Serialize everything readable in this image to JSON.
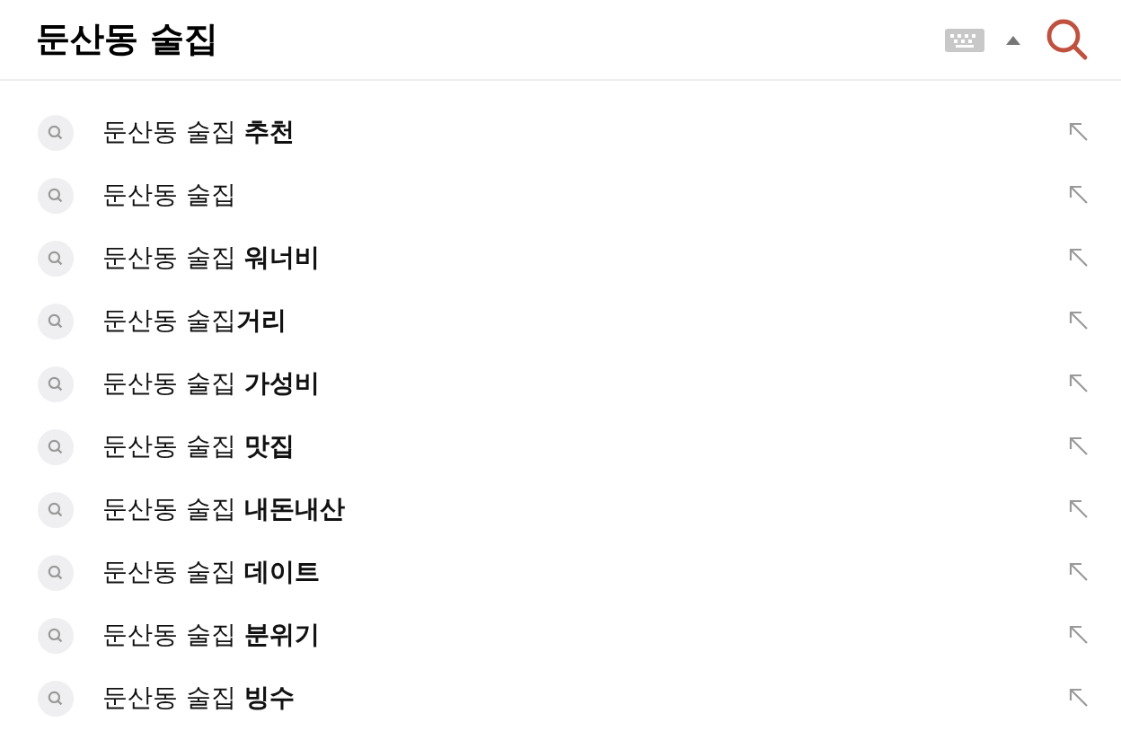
{
  "search": {
    "value": "둔산동 술집"
  },
  "suggestions": [
    {
      "text": "둔산동 술집 **추천**"
    },
    {
      "text": "둔산동 술집"
    },
    {
      "text": "둔산동 술집 **워너비**"
    },
    {
      "text": "둔산동 술집**거리**"
    },
    {
      "text": "둔산동 술집 **가성비**"
    },
    {
      "text": "둔산동 술집 **맛집**"
    },
    {
      "text": "둔산동 술집 **내돈내산**"
    },
    {
      "text": "둔산동 술집 **데이트**"
    },
    {
      "text": "둔산동 술집 **분위기**"
    },
    {
      "text": "둔산동 술집 **빙수**"
    }
  ]
}
